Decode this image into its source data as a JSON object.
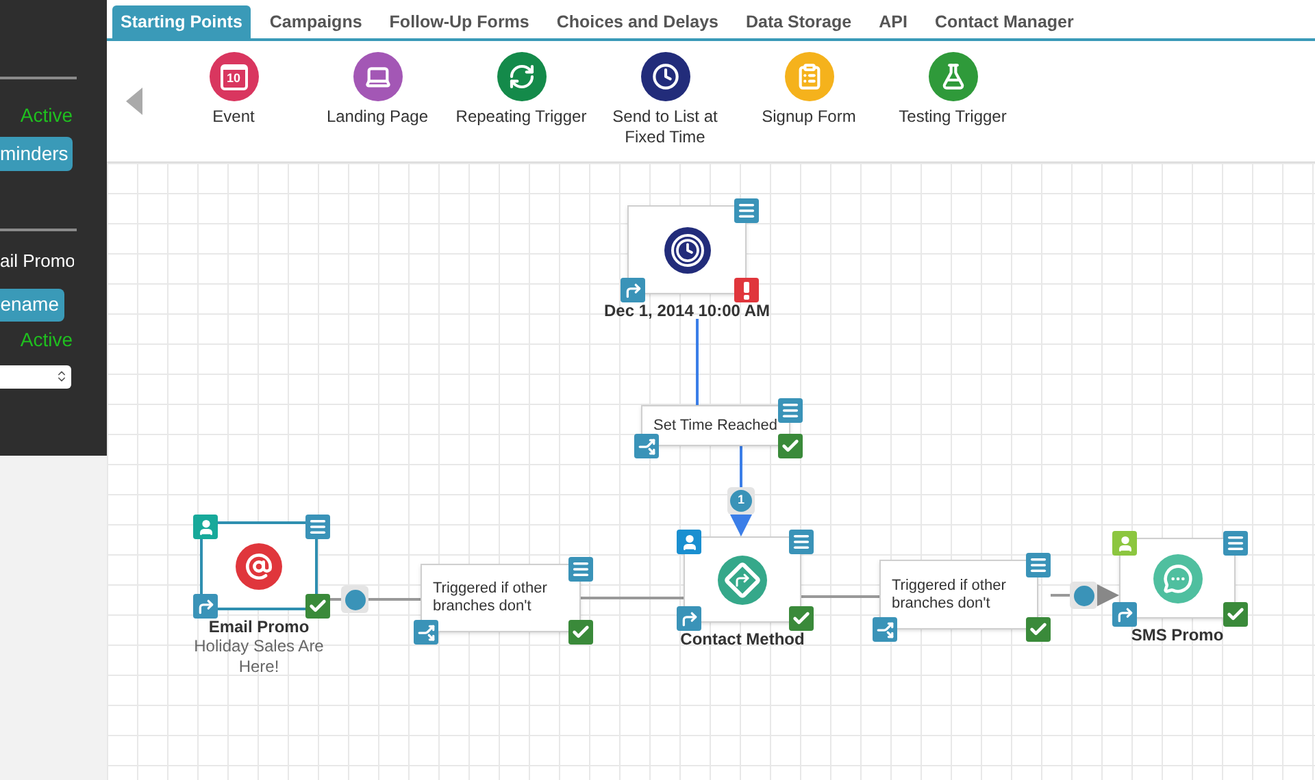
{
  "sidebar": {
    "status_top": "Active",
    "button_top": "minders",
    "title": "ail Promo",
    "button_bottom": "ename",
    "status_bottom": "Active"
  },
  "tabs": [
    {
      "label": "Starting Points",
      "selected": true
    },
    {
      "label": "Campaigns",
      "selected": false
    },
    {
      "label": "Follow-Up Forms",
      "selected": false
    },
    {
      "label": "Choices and Delays",
      "selected": false
    },
    {
      "label": "Data Storage",
      "selected": false
    },
    {
      "label": "API",
      "selected": false
    },
    {
      "label": "Contact Manager",
      "selected": false
    }
  ],
  "palette": [
    {
      "kind": "calendar",
      "label": "Event",
      "color": "#d9365f",
      "badge_text": "10"
    },
    {
      "kind": "laptop",
      "label": "Landing Page",
      "color": "#a357b5"
    },
    {
      "kind": "refresh",
      "label": "Repeating Trigger",
      "color": "#148a4a"
    },
    {
      "kind": "clock",
      "label": "Send to List at Fixed Time",
      "color": "#222c7a"
    },
    {
      "kind": "form",
      "label": "Signup Form",
      "color": "#f5b21c"
    },
    {
      "kind": "flask",
      "label": "Testing Trigger",
      "color": "#2f9a3a"
    }
  ],
  "nodes": [
    {
      "kind": "timer",
      "title": "Dec 1, 2014 10:00 AM",
      "complete": false,
      "selected": false
    },
    {
      "kind": "condition",
      "text": "Set Time Reached",
      "complete": true
    },
    {
      "kind": "email",
      "title": "Email Promo",
      "subtitle": "Holiday Sales Are Here!",
      "complete": true,
      "selected": true,
      "color": "#17a99a"
    },
    {
      "kind": "condition",
      "text": "Triggered if other branches don't",
      "complete": true
    },
    {
      "kind": "router",
      "title": "Contact Method",
      "complete": true,
      "selected": false,
      "color": "#1a8fd0"
    },
    {
      "kind": "condition",
      "text": "Triggered if other branches don't",
      "complete": true
    },
    {
      "kind": "sms",
      "title": "SMS Promo",
      "complete": true,
      "selected": false,
      "color": "#8cc63f"
    }
  ],
  "links": [
    {
      "kind": "numbered",
      "label": "1"
    },
    {
      "kind": "dot"
    },
    {
      "kind": "dot"
    }
  ]
}
